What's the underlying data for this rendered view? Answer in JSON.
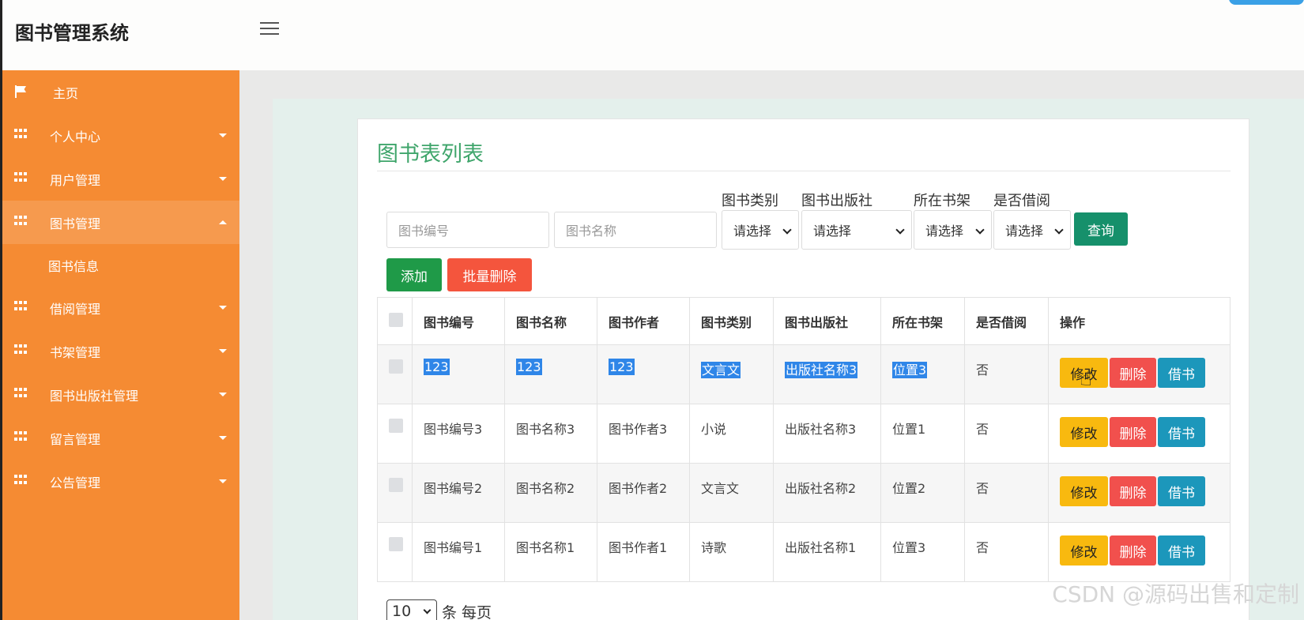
{
  "header": {
    "app_title": "图书管理系统"
  },
  "sidebar": {
    "items": [
      {
        "label": "主页",
        "icon": "flag-icon"
      },
      {
        "label": "个人中心",
        "icon": "grid-icon"
      },
      {
        "label": "用户管理",
        "icon": "grid-icon"
      },
      {
        "label": "图书管理",
        "icon": "grid-icon",
        "expanded": true
      },
      {
        "label": "图书信息",
        "sub": true
      },
      {
        "label": "借阅管理",
        "icon": "grid-icon"
      },
      {
        "label": "书架管理",
        "icon": "grid-icon"
      },
      {
        "label": "图书出版社管理",
        "icon": "grid-icon"
      },
      {
        "label": "留言管理",
        "icon": "grid-icon"
      },
      {
        "label": "公告管理",
        "icon": "grid-icon"
      }
    ]
  },
  "panel": {
    "title": "图书表列表",
    "search": {
      "book_no_placeholder": "图书编号",
      "book_name_placeholder": "图书名称",
      "filters": [
        {
          "label": "图书类别",
          "value": "请选择"
        },
        {
          "label": "图书出版社",
          "value": "请选择"
        },
        {
          "label": "所在书架",
          "value": "请选择"
        },
        {
          "label": "是否借阅",
          "value": "请选择"
        }
      ],
      "query_label": "查询"
    },
    "toolbar": {
      "add_label": "添加",
      "bulk_delete_label": "批量删除"
    },
    "table": {
      "headers": [
        "图书编号",
        "图书名称",
        "图书作者",
        "图书类别",
        "图书出版社",
        "所在书架",
        "是否借阅",
        "操作"
      ],
      "rows": [
        [
          "123",
          "123",
          "123",
          "文言文",
          "出版社名称3",
          "位置3",
          "否"
        ],
        [
          "图书编号3",
          "图书名称3",
          "图书作者3",
          "小说",
          "出版社名称3",
          "位置1",
          "否"
        ],
        [
          "图书编号2",
          "图书名称2",
          "图书作者2",
          "文言文",
          "出版社名称2",
          "位置2",
          "否"
        ],
        [
          "图书编号1",
          "图书名称1",
          "图书作者1",
          "诗歌",
          "出版社名称1",
          "位置3",
          "否"
        ]
      ],
      "actions": {
        "edit": "修改",
        "delete": "删除",
        "borrow": "借书"
      }
    },
    "pagination": {
      "page_size": "10",
      "per_page_text": "条 每页"
    }
  },
  "watermark": "CSDN @源码出售和定制",
  "colors": {
    "sidebar": "#f58b33",
    "title_green": "#3fa56b",
    "query": "#16906b",
    "add": "#1f9a48",
    "delete": "#f4553d",
    "edit": "#f8b90f",
    "borrow": "#1c97bb",
    "selection": "#2f86e8"
  }
}
